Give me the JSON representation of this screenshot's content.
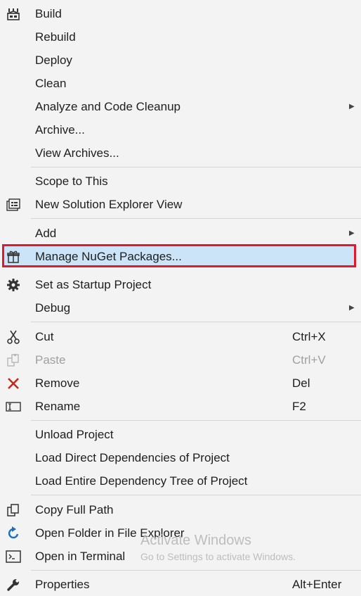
{
  "menu": {
    "build": "Build",
    "rebuild": "Rebuild",
    "deploy": "Deploy",
    "clean": "Clean",
    "analyze": "Analyze and Code Cleanup",
    "archive": "Archive...",
    "view_archives": "View Archives...",
    "scope": "Scope to This",
    "new_view": "New Solution Explorer View",
    "add": "Add",
    "nuget": "Manage NuGet Packages...",
    "startup": "Set as Startup Project",
    "debug": "Debug",
    "cut": "Cut",
    "cut_shortcut": "Ctrl+X",
    "paste": "Paste",
    "paste_shortcut": "Ctrl+V",
    "remove": "Remove",
    "remove_shortcut": "Del",
    "rename": "Rename",
    "rename_shortcut": "F2",
    "unload": "Unload Project",
    "load_direct": "Load Direct Dependencies of Project",
    "load_tree": "Load Entire Dependency Tree of Project",
    "copy_path": "Copy Full Path",
    "open_folder": "Open Folder in File Explorer",
    "open_terminal": "Open in Terminal",
    "properties": "Properties",
    "properties_shortcut": "Alt+Enter"
  },
  "watermark": {
    "title": "Activate Windows",
    "subtitle": "Go to Settings to activate Windows."
  },
  "colors": {
    "highlight_bg": "#cce4f7",
    "highlight_border": "#e01a2b",
    "remove_icon": "#c5281c",
    "folder_arrow": "#1a6fc2"
  }
}
